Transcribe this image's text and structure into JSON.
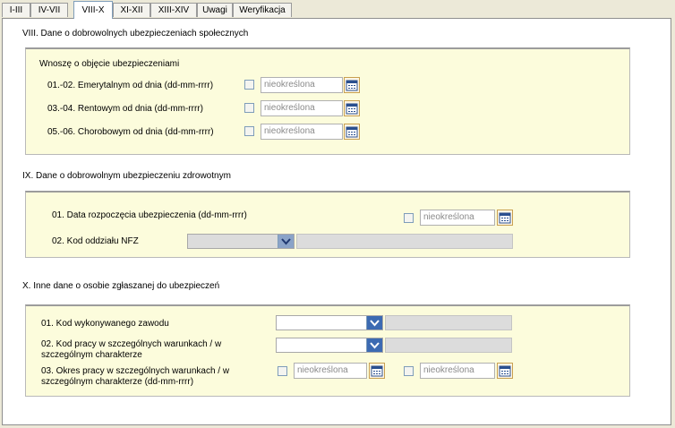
{
  "tabs": [
    "I-III",
    "IV-VII",
    "VIII-X",
    "XI-XII",
    "XIII-XIV",
    "Uwagi",
    "Weryfikacja"
  ],
  "active_tab": "VIII-X",
  "section8": {
    "title": "VIII. Dane o dobrowolnych ubezpieczeniach społecznych",
    "box_title": "Wnoszę o objęcie ubezpieczeniami",
    "rows": [
      {
        "label": "01.-02. Emerytalnym od dnia (dd-mm-rrrr)",
        "value": "nieokreślona"
      },
      {
        "label": "03.-04. Rentowym od dnia (dd-mm-rrrr)",
        "value": "nieokreślona"
      },
      {
        "label": "05.-06. Chorobowym od dnia (dd-mm-rrrr)",
        "value": "nieokreślona"
      }
    ]
  },
  "section9": {
    "title": "IX. Dane o dobrowolnym ubezpieczeniu zdrowotnym",
    "row1_label": "01. Data rozpoczęcia ubezpieczenia (dd-mm-rrrr)",
    "row1_value": "nieokreślona",
    "row2_label": "02. Kod oddziału NFZ"
  },
  "section10": {
    "title": "X. Inne dane o osobie zgłaszanej do ubezpieczeń",
    "row1_label": "01. Kod wykonywanego zawodu",
    "row2_label": "02.  Kod pracy w szczególnych warunkach / w szczególnym charakterze",
    "row3_label": "03. Okres pracy w szczególnych warunkach / w szczególnym charakterze (dd-mm-rrrr)",
    "row3_from": "nieokreślona",
    "row3_to": "nieokreślona"
  },
  "colors": {
    "box_bg": "#fcfcdc",
    "panel_bg": "#ffffff",
    "window_bg": "#ece9d8",
    "dropdown": "#3c6ab2"
  },
  "icons": {
    "calendar": "calendar-icon",
    "dropdown": "chevron-down-icon"
  }
}
